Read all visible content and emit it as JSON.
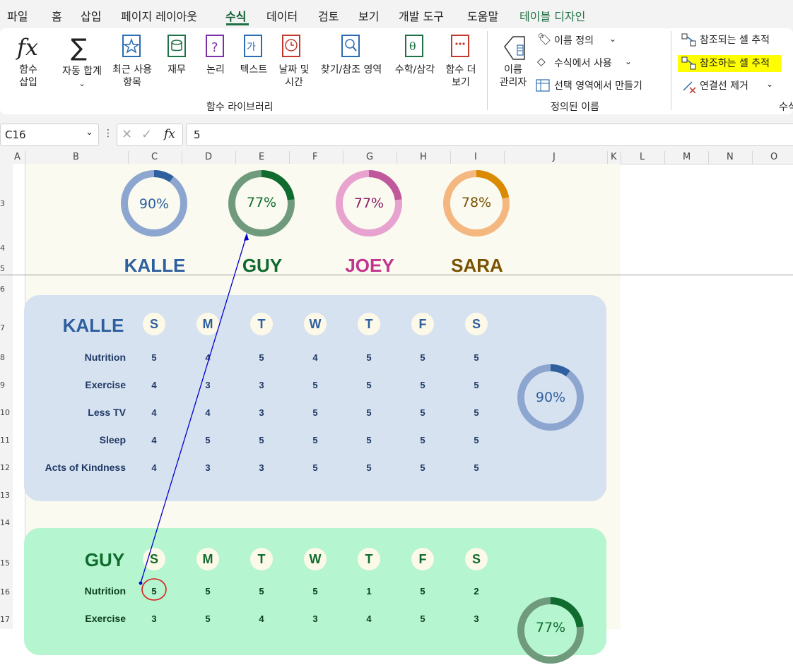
{
  "menu": {
    "tabs": [
      "파일",
      "홈",
      "삽입",
      "페이지 레이아웃",
      "수식",
      "데이터",
      "검토",
      "보기",
      "개발 도구",
      "도움말",
      "테이블 디자인"
    ],
    "active_tab": "수식"
  },
  "ribbon": {
    "insert_function": "함수\n삽입",
    "buttons": [
      "자동 합계",
      "최근 사용\n항목",
      "재무",
      "논리",
      "텍스트",
      "날짜 및\n시간",
      "찾기/참조 영역",
      "수학/삼각",
      "함수 더\n보기"
    ],
    "library_group_label": "함수 라이브러리",
    "name_manager": "이름\n관리자",
    "define_name": "이름 정의",
    "use_in_formula": "수식에서 사용",
    "create_from_selection": "선택 영역에서 만들기",
    "defined_names_group_label": "정의된 이름",
    "trace_precedents": "참조되는 셀 추적",
    "trace_dependents": "참조하는 셀 추적",
    "remove_arrows": "연결선 제거",
    "auditing_group_label_partial": "수식"
  },
  "formula_bar": {
    "name_box": "C16",
    "value": "5"
  },
  "columns": [
    "A",
    "B",
    "C",
    "D",
    "E",
    "F",
    "G",
    "H",
    "I",
    "J",
    "K",
    "L",
    "M",
    "N",
    "O"
  ],
  "rows": [
    "3",
    "4",
    "5",
    "6",
    "7",
    "8",
    "9",
    "10",
    "11",
    "12",
    "13",
    "14",
    "15",
    "16",
    "17"
  ],
  "colors": {
    "kalle": "#2e5f9e",
    "guy": "#0f6b2e",
    "joey": "#c2348f",
    "sara": "#7a5200",
    "kalle_panel": "#d7e2f1",
    "guy_panel": "#b5f5cf",
    "sheet_bg": "#fafaf0",
    "highlight": "#ffff00",
    "trace_arrow": "#0000cc"
  },
  "summary": [
    {
      "name": "KALLE",
      "percent": "90%",
      "fraction": 0.9
    },
    {
      "name": "GUY",
      "percent": "77%",
      "fraction": 0.77
    },
    {
      "name": "JOEY",
      "percent": "77%",
      "fraction": 0.77
    },
    {
      "name": "SARA",
      "percent": "78%",
      "fraction": 0.78
    }
  ],
  "days": [
    "S",
    "M",
    "T",
    "W",
    "T",
    "F",
    "S"
  ],
  "kalle": {
    "name": "KALLE",
    "percent": "90%",
    "fraction": 0.9,
    "rows": [
      {
        "label": "Nutrition",
        "values": [
          "5",
          "4",
          "5",
          "4",
          "5",
          "5",
          "5"
        ]
      },
      {
        "label": "Exercise",
        "values": [
          "4",
          "3",
          "3",
          "5",
          "5",
          "5",
          "5"
        ]
      },
      {
        "label": "Less TV",
        "values": [
          "4",
          "4",
          "3",
          "5",
          "5",
          "5",
          "5"
        ]
      },
      {
        "label": "Sleep",
        "values": [
          "4",
          "5",
          "5",
          "5",
          "5",
          "5",
          "5"
        ]
      },
      {
        "label": "Acts of Kindness",
        "values": [
          "4",
          "3",
          "3",
          "5",
          "5",
          "5",
          "5"
        ]
      }
    ]
  },
  "guy": {
    "name": "GUY",
    "percent": "77%",
    "fraction": 0.77,
    "rows": [
      {
        "label": "Nutrition",
        "values": [
          "5",
          "5",
          "5",
          "5",
          "1",
          "5",
          "2"
        ]
      },
      {
        "label": "Exercise",
        "values": [
          "3",
          "5",
          "4",
          "3",
          "4",
          "5",
          "3"
        ]
      }
    ]
  }
}
